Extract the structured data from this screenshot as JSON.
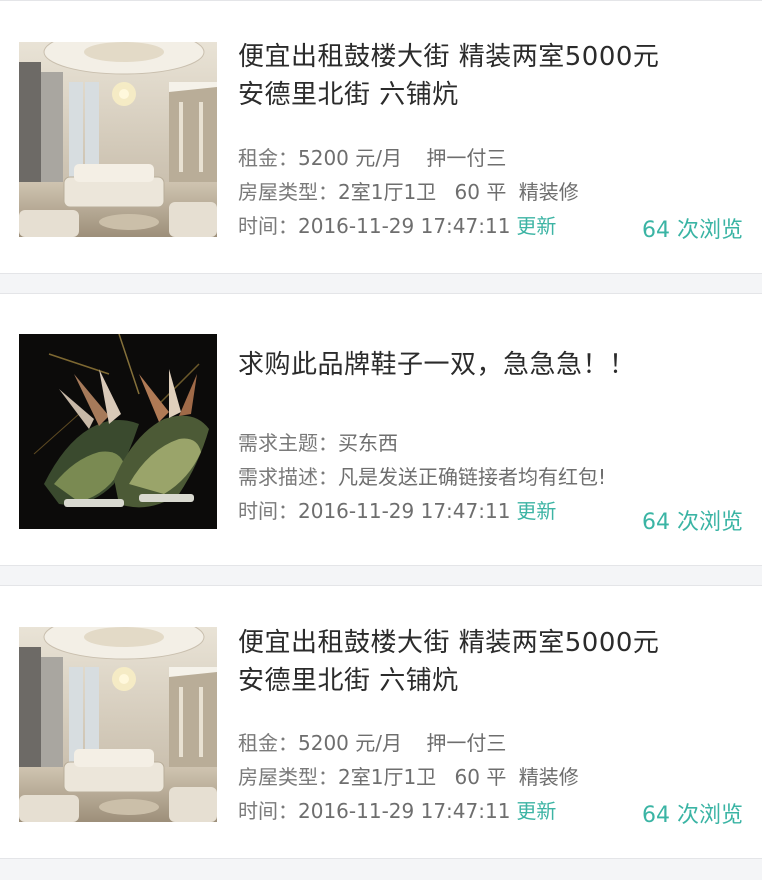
{
  "listings": [
    {
      "type": "rental",
      "thumb_icon": "living-room-photo",
      "title_line1": "便宜出租鼓楼大街 精装两室5000元",
      "title_line2": "安德里北街 六铺炕",
      "rent_label": "租金：",
      "rent_value": "5200 元/月",
      "deposit": "押一付三",
      "house_type_label": "房屋类型：",
      "house_type_value": "2室1厅1卫",
      "area": "60 平",
      "decoration": "精装修",
      "time_label": "时间：",
      "time_value": "2016-11-29 17:47:11",
      "refresh_label": "更新",
      "views": "64 次浏览"
    },
    {
      "type": "request",
      "thumb_icon": "winged-sneakers-photo",
      "title": "求购此品牌鞋子一双，急急急！！",
      "subject_label": "需求主题：",
      "subject_value": "买东西",
      "desc_label": "需求描述：",
      "desc_value": "凡是发送正确链接者均有红包!",
      "time_label": "时间：",
      "time_value": "2016-11-29 17:47:11",
      "refresh_label": "更新",
      "views": "64 次浏览"
    },
    {
      "type": "rental",
      "thumb_icon": "living-room-photo",
      "title_line1": "便宜出租鼓楼大街 精装两室5000元",
      "title_line2": "安德里北街 六铺炕",
      "rent_label": "租金：",
      "rent_value": "5200 元/月",
      "deposit": "押一付三",
      "house_type_label": "房屋类型：",
      "house_type_value": "2室1厅1卫",
      "area": "60 平",
      "decoration": "精装修",
      "time_label": "时间：",
      "time_value": "2016-11-29 17:47:11",
      "refresh_label": "更新",
      "views": "64 次浏览"
    }
  ],
  "colors": {
    "accent": "#3ab4a4",
    "title": "#2b2b2b",
    "meta": "#777777",
    "background": "#f4f5f7"
  }
}
